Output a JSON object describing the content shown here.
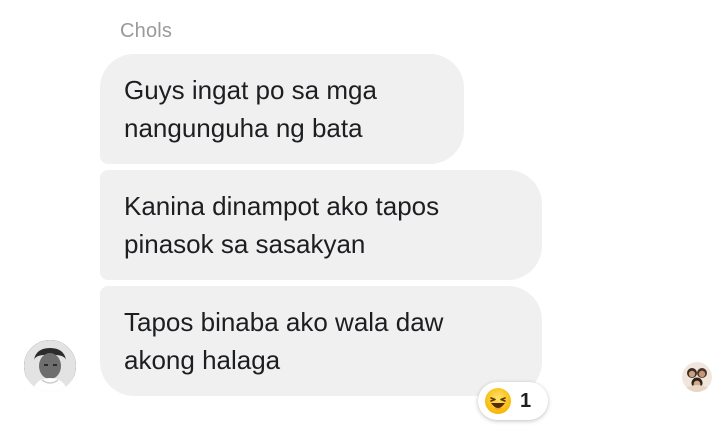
{
  "conversation": {
    "sender_name": "Chols",
    "messages": [
      {
        "lines": [
          "Guys ingat po sa mga",
          "nangunguha ng bata"
        ]
      },
      {
        "lines": [
          "Kanina dinampot ako tapos",
          "pinasok sa sasakyan"
        ]
      },
      {
        "lines": [
          "Tapos binaba ako wala daw",
          "akong halaga"
        ]
      }
    ],
    "reaction": {
      "emoji": "laughing-face-icon",
      "count": "1"
    }
  },
  "colors": {
    "bubble_bg": "#f1f0f0",
    "text": "#1c1e21",
    "sender_name": "#9a9a9a",
    "background": "#ffffff"
  }
}
